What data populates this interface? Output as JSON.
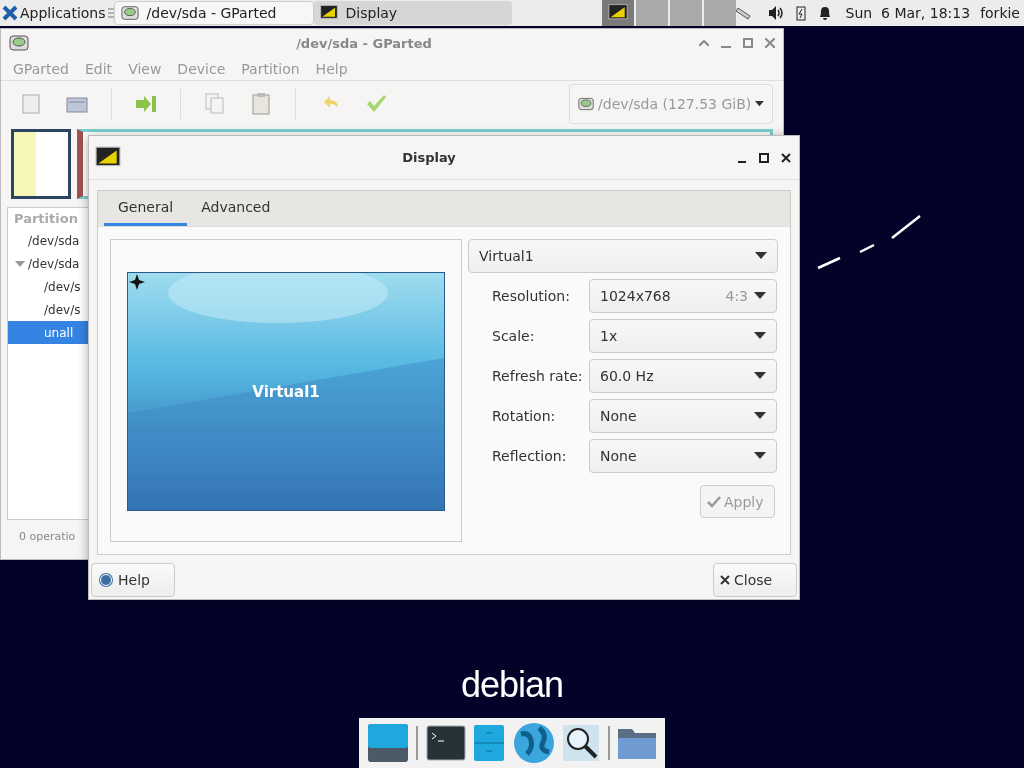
{
  "top_panel": {
    "applications": "Applications",
    "tasks": [
      {
        "label": "/dev/sda - GParted",
        "selected": false
      },
      {
        "label": "Display",
        "selected": true
      }
    ],
    "workspaces": [
      {
        "selected": true
      },
      {
        "selected": false
      },
      {
        "selected": false
      },
      {
        "selected": false
      }
    ],
    "clock": "Sun  6 Mar, 18:13",
    "user": "forkie"
  },
  "gparted": {
    "title": "/dev/sda - GParted",
    "menu": [
      "GParted",
      "Edit",
      "View",
      "Device",
      "Partition",
      "Help"
    ],
    "device": "/dev/sda (127.53 GiB)",
    "partition_header": "Partition",
    "partitions": [
      {
        "label": "/dev/sda",
        "expanded": false,
        "selected": false
      },
      {
        "label": "/dev/sda",
        "expanded": true,
        "selected": false,
        "children": [
          {
            "label": "/dev/s",
            "expanded": false,
            "selected": false
          },
          {
            "label": "/dev/s",
            "expanded": false,
            "selected": false
          },
          {
            "label": "unall",
            "expanded": false,
            "selected": true
          }
        ]
      }
    ],
    "status": "0 operatio"
  },
  "dialog": {
    "title": "Display",
    "tabs": [
      {
        "label": "General",
        "selected": true
      },
      {
        "label": "Advanced",
        "selected": false
      }
    ],
    "monitor": {
      "name": "Virtual1"
    },
    "output": "Virtual1",
    "settings": [
      {
        "label": "Resolution:",
        "value": "1024x768",
        "aspect": "4:3"
      },
      {
        "label": "Scale:",
        "value": "1x"
      },
      {
        "label": "Refresh rate:",
        "value": "60.0 Hz"
      },
      {
        "label": "Rotation:",
        "value": "None"
      },
      {
        "label": "Reflection:",
        "value": "None"
      }
    ],
    "apply": {
      "label": "Apply",
      "disabled": true
    },
    "help": "Help",
    "close": "Close"
  },
  "desktop": {
    "logo": "debian"
  }
}
